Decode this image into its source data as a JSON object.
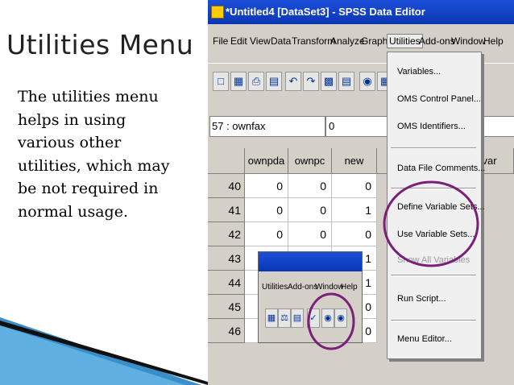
{
  "slide": {
    "title": "Utilities Menu",
    "body_lines": [
      "The utilities menu",
      "helps in using",
      "various other",
      "utilities, which may",
      "be not required in",
      "normal usage."
    ]
  },
  "window": {
    "title": "*Untitled4 [DataSet3] - SPSS Data Editor"
  },
  "menubar": {
    "items": [
      "File",
      "Edit",
      "View",
      "Data",
      "Transform",
      "Analyze",
      "Graphs",
      "Utilities",
      "Add-ons",
      "Window",
      "Help"
    ],
    "active": "Utilities"
  },
  "cell_editor": {
    "reference": "57 : ownfax",
    "value": "0"
  },
  "grid": {
    "columns": [
      "ownpda",
      "ownpc",
      "new",
      "",
      "",
      "var"
    ],
    "rows": [
      {
        "num": "40",
        "values": [
          "0",
          "0",
          "0"
        ]
      },
      {
        "num": "41",
        "values": [
          "0",
          "0",
          "1"
        ]
      },
      {
        "num": "42",
        "values": [
          "0",
          "0",
          "0"
        ]
      },
      {
        "num": "43",
        "values": [
          "",
          "",
          "1"
        ]
      },
      {
        "num": "44",
        "values": [
          "",
          "",
          "1"
        ]
      },
      {
        "num": "45",
        "values": [
          "",
          "",
          "0"
        ]
      },
      {
        "num": "46",
        "values": [
          "0",
          "0",
          "0"
        ]
      }
    ]
  },
  "utilities_menu": {
    "items": [
      "Variables...",
      "OMS Control Panel...",
      "OMS Identifiers...",
      "Data File Comments...",
      "Define Variable Sets...",
      "Use Variable Sets...",
      "Show All Variables",
      "Run Script...",
      "Menu Editor..."
    ],
    "disabled": [
      "Show All Variables"
    ]
  },
  "inset_toolbar": {
    "menu_items": [
      "Utilities",
      "Add-ons",
      "Window",
      "Help"
    ]
  },
  "colors": {
    "titlebar": "#0a36b4",
    "highlight_circle": "#7a1f7a",
    "window_bg": "#d4d0c8"
  }
}
